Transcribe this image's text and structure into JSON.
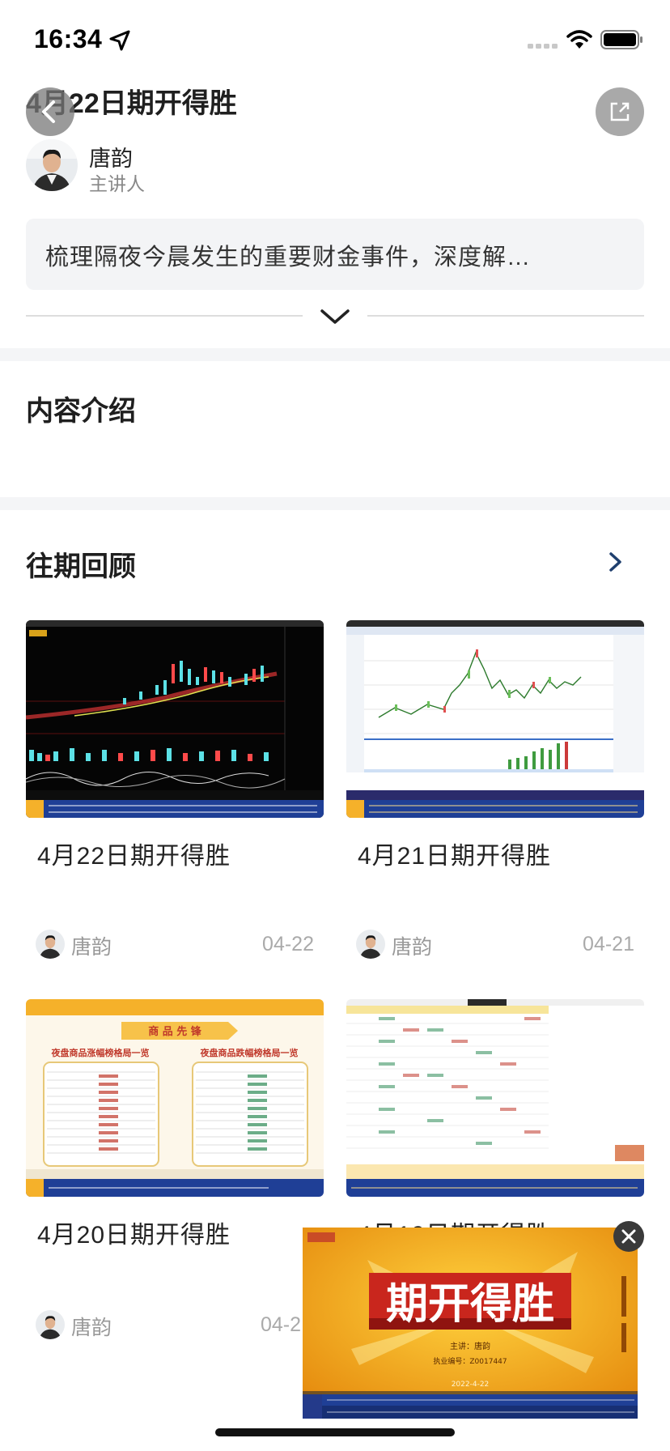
{
  "status_bar": {
    "time": "16:34",
    "icons": [
      "location-arrow-icon",
      "signal-icon",
      "wifi-icon",
      "battery-icon"
    ]
  },
  "header": {
    "title": "4月22日期开得胜",
    "back_icon": "chevron-left-icon",
    "share_icon": "share-icon"
  },
  "speaker": {
    "name": "唐韵",
    "role": "主讲人"
  },
  "summary": {
    "text": "梳理隔夜今晨发生的重要财金事件，深度解…",
    "expand_icon": "chevron-down-icon"
  },
  "intro_section": {
    "title": "内容介绍"
  },
  "history_section": {
    "title": "往期回顾",
    "more_icon": "chevron-right-icon",
    "items": [
      {
        "title": "4月22日期开得胜",
        "author": "唐韵",
        "date": "04-22"
      },
      {
        "title": "4月21日期开得胜",
        "author": "唐韵",
        "date": "04-21"
      },
      {
        "title": "4月20日期开得胜",
        "author": "唐韵",
        "date": "04-2"
      },
      {
        "title": "4月19日期开得胜",
        "author": "",
        "date": ""
      }
    ]
  },
  "thumb_texts": {
    "commodity_banner": "商 品 先 锋",
    "rise_table_title": "夜盘商品涨幅榜格局一览",
    "fall_table_title": "夜盘商品跌幅榜格局一览"
  },
  "mini_player": {
    "headline": "期开得胜",
    "presenter_line": "主讲：唐韵",
    "license_line": "执业编号：Z0017447",
    "date_line": "2022-4-22",
    "close_icon": "close-icon"
  },
  "colors": {
    "accent_gold": "#f5b12a",
    "chart_dark": "#0a0a0a",
    "candle_cyan": "#5ce1e6",
    "ticker_blue": "#1f3f96"
  }
}
